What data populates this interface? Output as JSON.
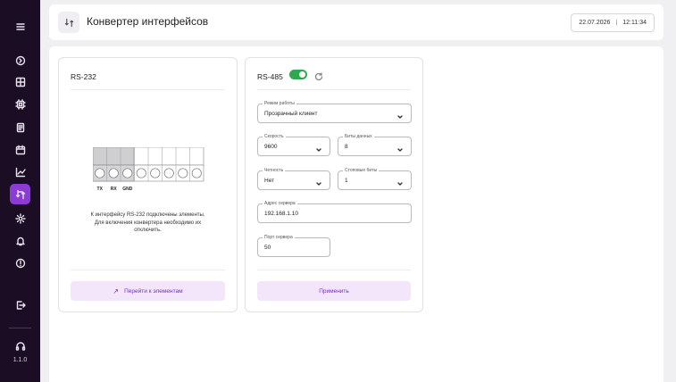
{
  "app": {
    "version": "1.1.0"
  },
  "header": {
    "title": "Конвертер интерфейсов",
    "date": "22.07.2026",
    "separator": "|",
    "time": "12:11:34"
  },
  "sidebar": {
    "items": [
      {
        "icon": "menu-icon",
        "active": false
      },
      {
        "icon": "dashboard-icon",
        "active": false
      },
      {
        "icon": "grid-icon",
        "active": false
      },
      {
        "icon": "cpu-icon",
        "active": false
      },
      {
        "icon": "document-icon",
        "active": false
      },
      {
        "icon": "calendar-icon",
        "active": false
      },
      {
        "icon": "chart-icon",
        "active": false
      },
      {
        "icon": "converter-icon",
        "active": true
      },
      {
        "icon": "settings-icon",
        "active": false
      },
      {
        "icon": "bell-icon",
        "active": false
      },
      {
        "icon": "info-icon",
        "active": false
      },
      {
        "icon": "logout-icon",
        "active": false
      },
      {
        "icon": "headset-icon",
        "active": false
      }
    ]
  },
  "rs232": {
    "title": "RS-232",
    "pins": [
      "TX",
      "RX",
      "GND"
    ],
    "caption_line1": "К интерфейсу RS-232 подключены элементы.",
    "caption_line2": "Для включения конвертера необходимо их",
    "caption_line3": "отключить.",
    "go_button": "Перейти к элементам",
    "go_icon": "arrow-up-right-icon"
  },
  "rs485": {
    "title": "RS-485",
    "enabled": true,
    "mode": {
      "label": "Режим работы",
      "value": "Прозрачный клиент"
    },
    "speed": {
      "label": "Скорость",
      "value": "9600"
    },
    "data_bits": {
      "label": "Биты данных",
      "value": "8"
    },
    "parity": {
      "label": "Четность",
      "value": "Нет"
    },
    "stop_bits": {
      "label": "Стоповые биты",
      "value": "1"
    },
    "server_address": {
      "label": "Адрес сервера",
      "value": "192.168.1.10"
    },
    "server_port": {
      "label": "Порт сервера",
      "value": "50"
    },
    "apply_button": "Применить"
  },
  "colors": {
    "sidebar_bg": "#1a0d24",
    "accent": "#8b3bd6",
    "button_bg": "#f3e6fb",
    "button_text": "#7a2cc4",
    "toggle_on": "#2fa84f"
  }
}
